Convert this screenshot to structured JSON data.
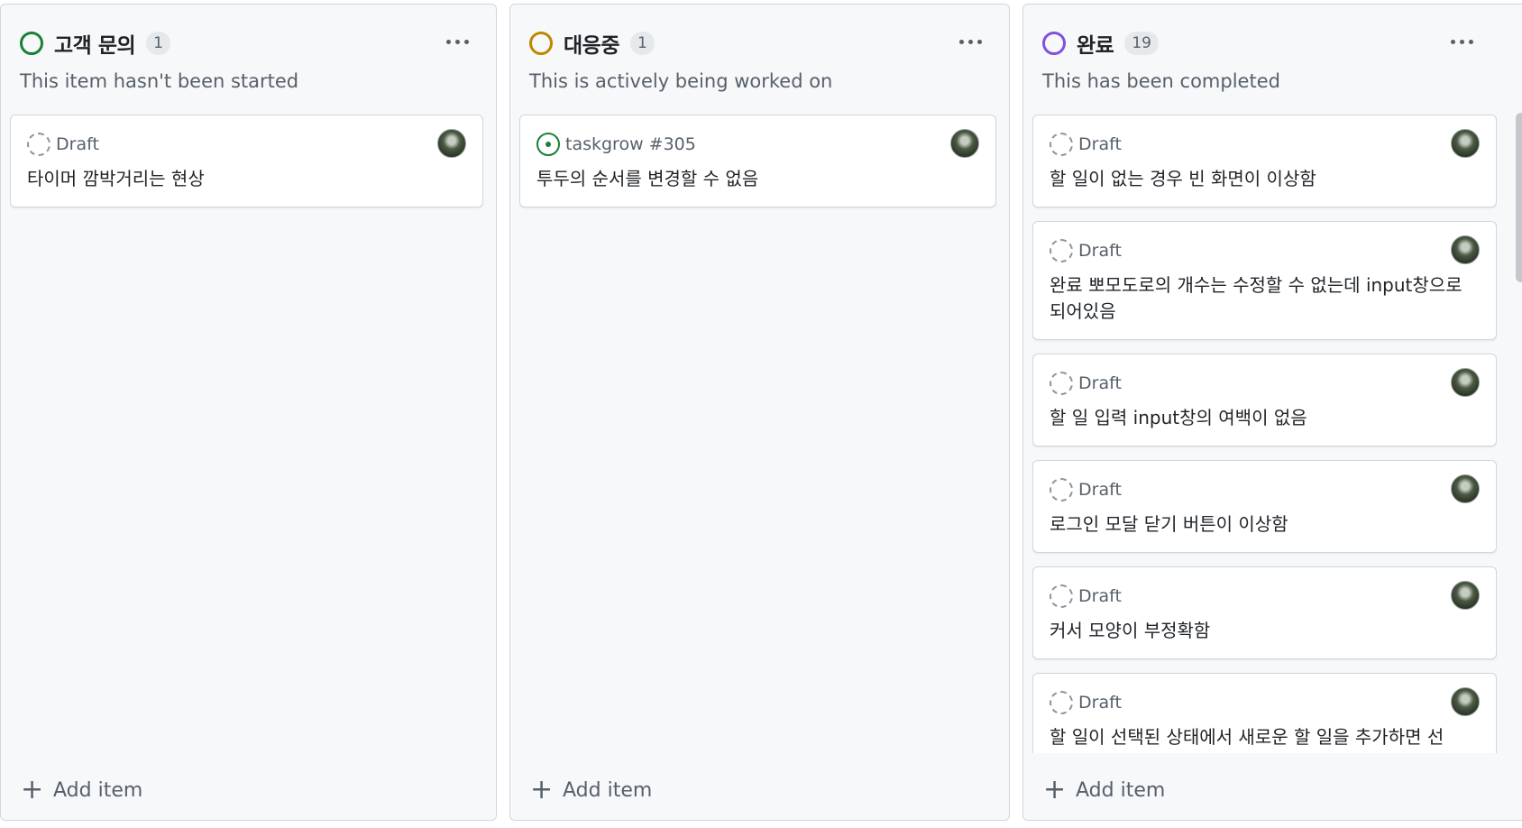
{
  "colors": {
    "todo": "#1a7f37",
    "in_progress": "#bf8700",
    "done": "#8250df"
  },
  "columns": [
    {
      "title": "고객 문의",
      "count": "1",
      "description": "This item hasn't been started",
      "add_label": "Add item",
      "cards": [
        {
          "type": "Draft",
          "title": "타이머 깜박거리는 현상"
        }
      ]
    },
    {
      "title": "대응중",
      "count": "1",
      "description": "This is actively being worked on",
      "add_label": "Add item",
      "cards": [
        {
          "type": "taskgrow #305",
          "title": "투두의 순서를 변경할 수 없음"
        }
      ]
    },
    {
      "title": "완료",
      "count": "19",
      "description": "This has been completed",
      "add_label": "Add item",
      "cards": [
        {
          "type": "Draft",
          "title": "할 일이 없는 경우 빈 화면이 이상함"
        },
        {
          "type": "Draft",
          "title": "완료 뽀모도로의 개수는 수정할 수 없는데 input창으로 되어있음"
        },
        {
          "type": "Draft",
          "title": "할 일 입력 input창의 여백이 없음"
        },
        {
          "type": "Draft",
          "title": "로그인 모달 닫기 버튼이 이상함"
        },
        {
          "type": "Draft",
          "title": "커서 모양이 부정확함"
        },
        {
          "type": "Draft",
          "title": "할 일이 선택된 상태에서 새로운 할 일을 추가하면 선"
        }
      ]
    }
  ]
}
